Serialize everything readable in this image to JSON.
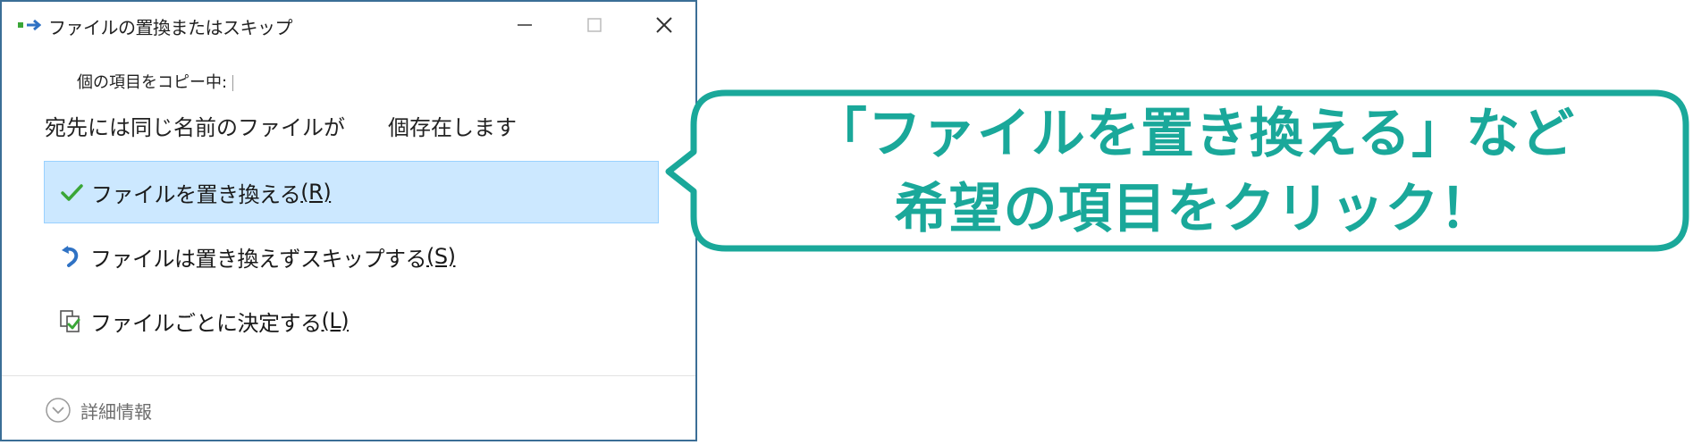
{
  "dialog": {
    "title": "ファイルの置換またはスキップ",
    "copy_status": "個の項目をコピー中:",
    "destination_message": "宛先には同じ名前のファイルが　　個存在します",
    "options": [
      {
        "label": "ファイルを置き換える",
        "key": "(R)",
        "icon": "checkmark-icon",
        "selected": true
      },
      {
        "label": "ファイルは置き換えずスキップする",
        "key": "(S)",
        "icon": "skip-arrow-icon",
        "selected": false
      },
      {
        "label": "ファイルごとに決定する",
        "key": "(L)",
        "icon": "compare-files-icon",
        "selected": false
      }
    ],
    "details_label": "詳細情報",
    "window_controls": [
      "minimize-icon",
      "maximize-icon",
      "close-icon"
    ]
  },
  "callout": {
    "line1": "「ファイルを置き換える」など",
    "line2": "希望の項目をクリック！",
    "color": "#1aa89a"
  },
  "colors": {
    "selected_bg": "#cce8ff",
    "selected_border": "#99d1ff",
    "check_green": "#3aa637",
    "skip_blue": "#2f72c4"
  }
}
